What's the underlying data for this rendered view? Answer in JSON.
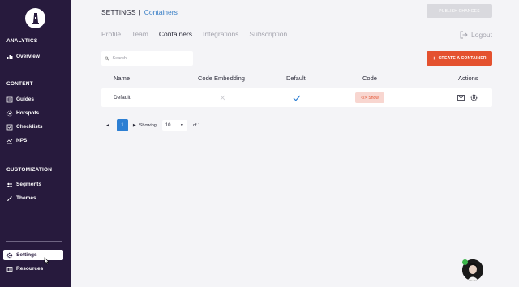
{
  "sidebar": {
    "sections": [
      {
        "title": "ANALYTICS",
        "items": [
          {
            "label": "Overview",
            "icon": "bar-chart-icon"
          }
        ]
      },
      {
        "title": "CONTENT",
        "items": [
          {
            "label": "Guides",
            "icon": "list-icon"
          },
          {
            "label": "Hotspots",
            "icon": "hotspot-icon"
          },
          {
            "label": "Checklists",
            "icon": "checkbox-icon"
          },
          {
            "label": "NPS",
            "icon": "nps-icon"
          }
        ]
      },
      {
        "title": "CUSTOMIZATION",
        "items": [
          {
            "label": "Segments",
            "icon": "segments-icon"
          },
          {
            "label": "Themes",
            "icon": "brush-icon"
          }
        ]
      }
    ],
    "bottom": [
      {
        "label": "Settings",
        "icon": "gear-icon",
        "active": true
      },
      {
        "label": "Resources",
        "icon": "book-icon"
      }
    ]
  },
  "header": {
    "title": "SETTINGS",
    "separator": "|",
    "subtitle": "Containers",
    "publish_label": "PUBLISH CHANGES"
  },
  "tabs": [
    {
      "label": "Profile",
      "active": false
    },
    {
      "label": "Team",
      "active": false
    },
    {
      "label": "Containers",
      "active": true
    },
    {
      "label": "Integrations",
      "active": false
    },
    {
      "label": "Subscription",
      "active": false
    }
  ],
  "logout_label": "Logout",
  "search": {
    "placeholder": "Search"
  },
  "create_label": "CREATE A CONTAINER",
  "table": {
    "columns": [
      "Name",
      "Code Embedding",
      "Default",
      "Code",
      "Actions"
    ],
    "rows": [
      {
        "name": "Default",
        "code_embedding": false,
        "default": true,
        "code_label": "Show"
      }
    ]
  },
  "pagination": {
    "page": "1",
    "showing_label": "Showing",
    "per_page": "10",
    "of_label": "of 1"
  },
  "colors": {
    "sidebar_bg": "#271a3d",
    "accent_orange": "#e4512f",
    "link_blue": "#3a7fc6",
    "page_button_blue": "#2d7fd3"
  }
}
